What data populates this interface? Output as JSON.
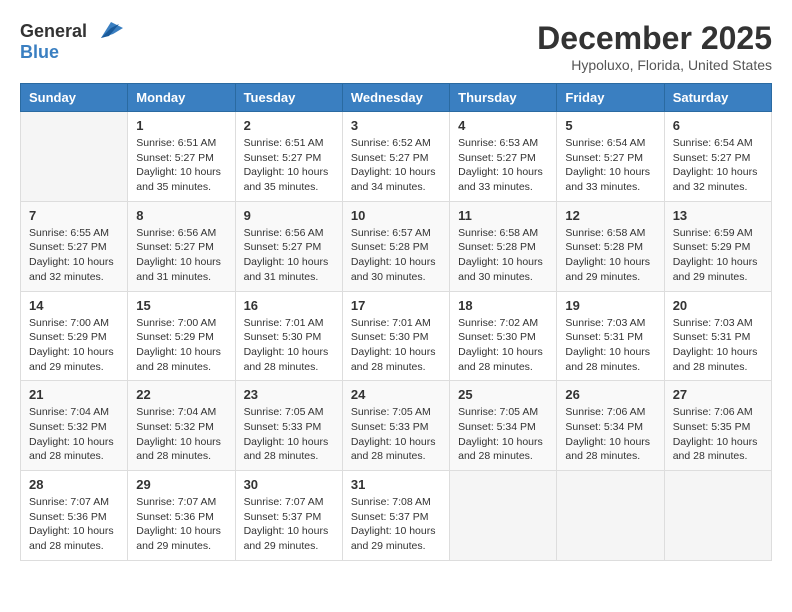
{
  "header": {
    "logo_general": "General",
    "logo_blue": "Blue",
    "month_title": "December 2025",
    "location": "Hypoluxo, Florida, United States"
  },
  "days_of_week": [
    "Sunday",
    "Monday",
    "Tuesday",
    "Wednesday",
    "Thursday",
    "Friday",
    "Saturday"
  ],
  "weeks": [
    [
      {
        "day": "",
        "sunrise": "",
        "sunset": "",
        "daylight": ""
      },
      {
        "day": "1",
        "sunrise": "Sunrise: 6:51 AM",
        "sunset": "Sunset: 5:27 PM",
        "daylight": "Daylight: 10 hours and 35 minutes."
      },
      {
        "day": "2",
        "sunrise": "Sunrise: 6:51 AM",
        "sunset": "Sunset: 5:27 PM",
        "daylight": "Daylight: 10 hours and 35 minutes."
      },
      {
        "day": "3",
        "sunrise": "Sunrise: 6:52 AM",
        "sunset": "Sunset: 5:27 PM",
        "daylight": "Daylight: 10 hours and 34 minutes."
      },
      {
        "day": "4",
        "sunrise": "Sunrise: 6:53 AM",
        "sunset": "Sunset: 5:27 PM",
        "daylight": "Daylight: 10 hours and 33 minutes."
      },
      {
        "day": "5",
        "sunrise": "Sunrise: 6:54 AM",
        "sunset": "Sunset: 5:27 PM",
        "daylight": "Daylight: 10 hours and 33 minutes."
      },
      {
        "day": "6",
        "sunrise": "Sunrise: 6:54 AM",
        "sunset": "Sunset: 5:27 PM",
        "daylight": "Daylight: 10 hours and 32 minutes."
      }
    ],
    [
      {
        "day": "7",
        "sunrise": "Sunrise: 6:55 AM",
        "sunset": "Sunset: 5:27 PM",
        "daylight": "Daylight: 10 hours and 32 minutes."
      },
      {
        "day": "8",
        "sunrise": "Sunrise: 6:56 AM",
        "sunset": "Sunset: 5:27 PM",
        "daylight": "Daylight: 10 hours and 31 minutes."
      },
      {
        "day": "9",
        "sunrise": "Sunrise: 6:56 AM",
        "sunset": "Sunset: 5:27 PM",
        "daylight": "Daylight: 10 hours and 31 minutes."
      },
      {
        "day": "10",
        "sunrise": "Sunrise: 6:57 AM",
        "sunset": "Sunset: 5:28 PM",
        "daylight": "Daylight: 10 hours and 30 minutes."
      },
      {
        "day": "11",
        "sunrise": "Sunrise: 6:58 AM",
        "sunset": "Sunset: 5:28 PM",
        "daylight": "Daylight: 10 hours and 30 minutes."
      },
      {
        "day": "12",
        "sunrise": "Sunrise: 6:58 AM",
        "sunset": "Sunset: 5:28 PM",
        "daylight": "Daylight: 10 hours and 29 minutes."
      },
      {
        "day": "13",
        "sunrise": "Sunrise: 6:59 AM",
        "sunset": "Sunset: 5:29 PM",
        "daylight": "Daylight: 10 hours and 29 minutes."
      }
    ],
    [
      {
        "day": "14",
        "sunrise": "Sunrise: 7:00 AM",
        "sunset": "Sunset: 5:29 PM",
        "daylight": "Daylight: 10 hours and 29 minutes."
      },
      {
        "day": "15",
        "sunrise": "Sunrise: 7:00 AM",
        "sunset": "Sunset: 5:29 PM",
        "daylight": "Daylight: 10 hours and 28 minutes."
      },
      {
        "day": "16",
        "sunrise": "Sunrise: 7:01 AM",
        "sunset": "Sunset: 5:30 PM",
        "daylight": "Daylight: 10 hours and 28 minutes."
      },
      {
        "day": "17",
        "sunrise": "Sunrise: 7:01 AM",
        "sunset": "Sunset: 5:30 PM",
        "daylight": "Daylight: 10 hours and 28 minutes."
      },
      {
        "day": "18",
        "sunrise": "Sunrise: 7:02 AM",
        "sunset": "Sunset: 5:30 PM",
        "daylight": "Daylight: 10 hours and 28 minutes."
      },
      {
        "day": "19",
        "sunrise": "Sunrise: 7:03 AM",
        "sunset": "Sunset: 5:31 PM",
        "daylight": "Daylight: 10 hours and 28 minutes."
      },
      {
        "day": "20",
        "sunrise": "Sunrise: 7:03 AM",
        "sunset": "Sunset: 5:31 PM",
        "daylight": "Daylight: 10 hours and 28 minutes."
      }
    ],
    [
      {
        "day": "21",
        "sunrise": "Sunrise: 7:04 AM",
        "sunset": "Sunset: 5:32 PM",
        "daylight": "Daylight: 10 hours and 28 minutes."
      },
      {
        "day": "22",
        "sunrise": "Sunrise: 7:04 AM",
        "sunset": "Sunset: 5:32 PM",
        "daylight": "Daylight: 10 hours and 28 minutes."
      },
      {
        "day": "23",
        "sunrise": "Sunrise: 7:05 AM",
        "sunset": "Sunset: 5:33 PM",
        "daylight": "Daylight: 10 hours and 28 minutes."
      },
      {
        "day": "24",
        "sunrise": "Sunrise: 7:05 AM",
        "sunset": "Sunset: 5:33 PM",
        "daylight": "Daylight: 10 hours and 28 minutes."
      },
      {
        "day": "25",
        "sunrise": "Sunrise: 7:05 AM",
        "sunset": "Sunset: 5:34 PM",
        "daylight": "Daylight: 10 hours and 28 minutes."
      },
      {
        "day": "26",
        "sunrise": "Sunrise: 7:06 AM",
        "sunset": "Sunset: 5:34 PM",
        "daylight": "Daylight: 10 hours and 28 minutes."
      },
      {
        "day": "27",
        "sunrise": "Sunrise: 7:06 AM",
        "sunset": "Sunset: 5:35 PM",
        "daylight": "Daylight: 10 hours and 28 minutes."
      }
    ],
    [
      {
        "day": "28",
        "sunrise": "Sunrise: 7:07 AM",
        "sunset": "Sunset: 5:36 PM",
        "daylight": "Daylight: 10 hours and 28 minutes."
      },
      {
        "day": "29",
        "sunrise": "Sunrise: 7:07 AM",
        "sunset": "Sunset: 5:36 PM",
        "daylight": "Daylight: 10 hours and 29 minutes."
      },
      {
        "day": "30",
        "sunrise": "Sunrise: 7:07 AM",
        "sunset": "Sunset: 5:37 PM",
        "daylight": "Daylight: 10 hours and 29 minutes."
      },
      {
        "day": "31",
        "sunrise": "Sunrise: 7:08 AM",
        "sunset": "Sunset: 5:37 PM",
        "daylight": "Daylight: 10 hours and 29 minutes."
      },
      {
        "day": "",
        "sunrise": "",
        "sunset": "",
        "daylight": ""
      },
      {
        "day": "",
        "sunrise": "",
        "sunset": "",
        "daylight": ""
      },
      {
        "day": "",
        "sunrise": "",
        "sunset": "",
        "daylight": ""
      }
    ]
  ]
}
